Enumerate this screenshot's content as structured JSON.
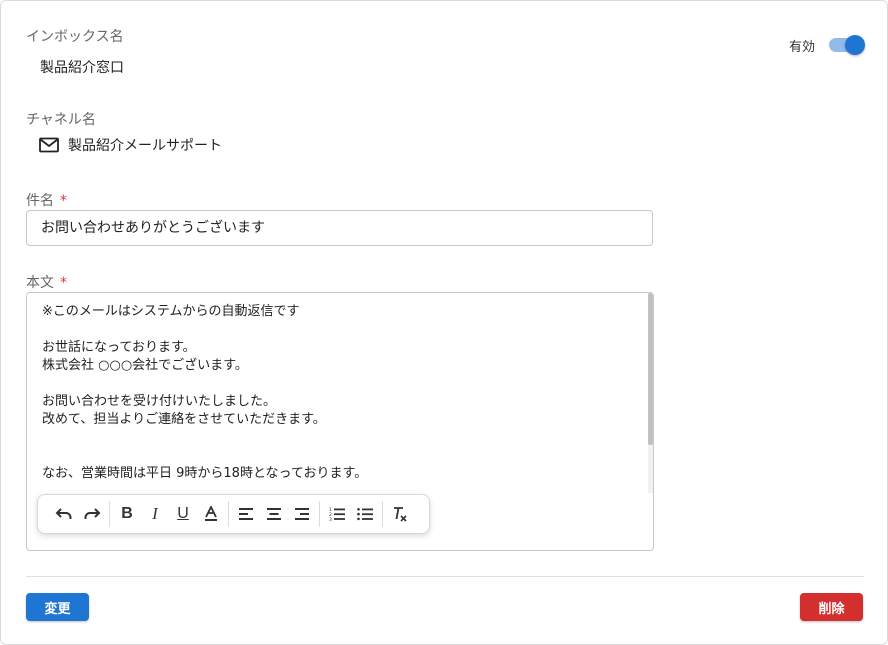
{
  "inbox": {
    "label": "インボックス名",
    "value": "製品紹介窓口"
  },
  "status": {
    "label": "有効",
    "enabled": true,
    "accent": "#1e76d2"
  },
  "channel": {
    "label": "チャネル名",
    "icon": "mail-icon",
    "value": "製品紹介メールサポート"
  },
  "subject": {
    "label": "件名",
    "required_mark": "*",
    "value": "お問い合わせありがとうございます"
  },
  "body": {
    "label": "本文",
    "required_mark": "*",
    "content": "※このメールはシステムからの自動返信です\n\nお世話になっております。\n株式会社 ○○○会社でございます。\n\nお問い合わせを受け付けいたしました。\n改めて、担当よりご連絡をさせていただきます。\n\n\nなお、営業時間は平日 9時から18時となっております。"
  },
  "toolbar": {
    "buttons": [
      {
        "icon": "undo-icon",
        "glyph": "↶"
      },
      {
        "icon": "redo-icon",
        "glyph": "↷"
      },
      {
        "icon": "bold-icon",
        "glyph": "B"
      },
      {
        "icon": "italic-icon",
        "glyph": "I"
      },
      {
        "icon": "underline-icon",
        "glyph": "U"
      },
      {
        "icon": "text-color-icon",
        "glyph": "A"
      },
      {
        "icon": "align-left-icon",
        "glyph": "≡"
      },
      {
        "icon": "align-center-icon",
        "glyph": "≡"
      },
      {
        "icon": "align-right-icon",
        "glyph": "≡"
      },
      {
        "icon": "numbered-list-icon",
        "glyph": "⋮≡"
      },
      {
        "icon": "bullet-list-icon",
        "glyph": "⁝≡"
      },
      {
        "icon": "clear-format-icon",
        "glyph": "Tx"
      }
    ]
  },
  "actions": {
    "save_label": "変更",
    "delete_label": "削除",
    "save_color": "#1e76d2",
    "delete_color": "#d32f2f"
  }
}
